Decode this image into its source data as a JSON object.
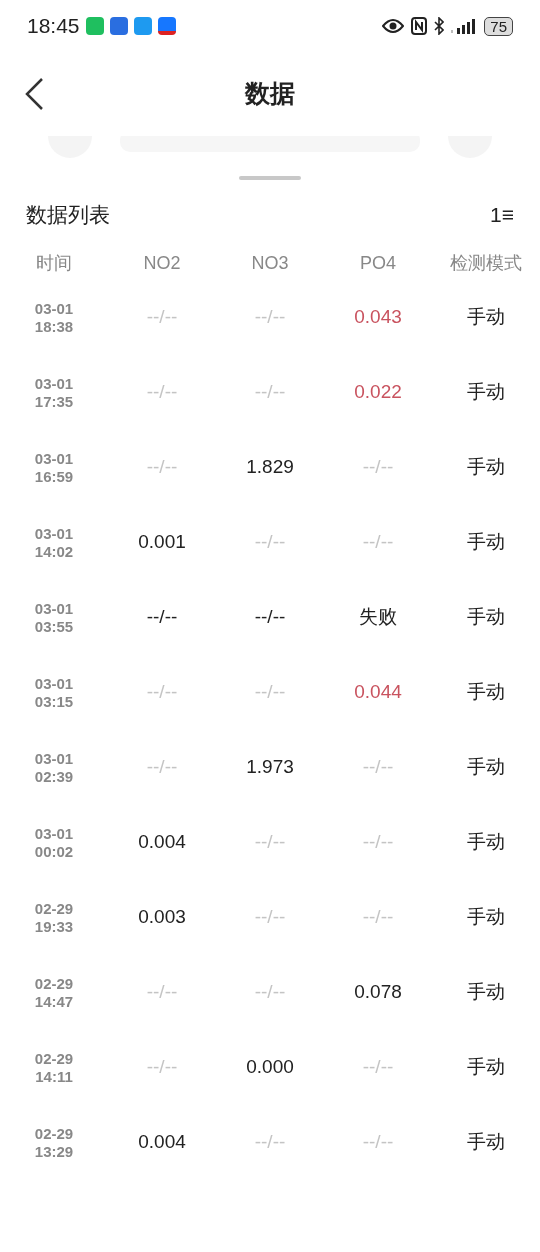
{
  "status_bar": {
    "time": "18:45",
    "battery": "75"
  },
  "header": {
    "title": "数据"
  },
  "list": {
    "title": "数据列表",
    "sort_label": "1≡"
  },
  "table": {
    "columns": [
      "时间",
      "NO2",
      "NO3",
      "PO4",
      "检测模式"
    ],
    "rows": [
      {
        "cells": [
          {
            "text": "03-01 18:38",
            "kind": "time"
          },
          {
            "text": "--/--",
            "kind": "empty"
          },
          {
            "text": "--/--",
            "kind": "empty"
          },
          {
            "text": "0.043",
            "kind": "high"
          },
          {
            "text": "手动",
            "kind": "normal"
          }
        ]
      },
      {
        "cells": [
          {
            "text": "03-01 17:35",
            "kind": "time"
          },
          {
            "text": "--/--",
            "kind": "empty"
          },
          {
            "text": "--/--",
            "kind": "empty"
          },
          {
            "text": "0.022",
            "kind": "high"
          },
          {
            "text": "手动",
            "kind": "normal"
          }
        ]
      },
      {
        "cells": [
          {
            "text": "03-01 16:59",
            "kind": "time"
          },
          {
            "text": "--/--",
            "kind": "empty"
          },
          {
            "text": "1.829",
            "kind": "normal"
          },
          {
            "text": "--/--",
            "kind": "empty"
          },
          {
            "text": "手动",
            "kind": "normal"
          }
        ]
      },
      {
        "cells": [
          {
            "text": "03-01 14:02",
            "kind": "time"
          },
          {
            "text": "0.001",
            "kind": "normal"
          },
          {
            "text": "--/--",
            "kind": "empty"
          },
          {
            "text": "--/--",
            "kind": "empty"
          },
          {
            "text": "手动",
            "kind": "normal"
          }
        ]
      },
      {
        "cells": [
          {
            "text": "03-01 03:55",
            "kind": "time"
          },
          {
            "text": "--/--",
            "kind": "normal"
          },
          {
            "text": "--/--",
            "kind": "normal"
          },
          {
            "text": "失败",
            "kind": "normal"
          },
          {
            "text": "手动",
            "kind": "normal"
          }
        ]
      },
      {
        "cells": [
          {
            "text": "03-01 03:15",
            "kind": "time"
          },
          {
            "text": "--/--",
            "kind": "empty"
          },
          {
            "text": "--/--",
            "kind": "empty"
          },
          {
            "text": "0.044",
            "kind": "high"
          },
          {
            "text": "手动",
            "kind": "normal"
          }
        ]
      },
      {
        "cells": [
          {
            "text": "03-01 02:39",
            "kind": "time"
          },
          {
            "text": "--/--",
            "kind": "empty"
          },
          {
            "text": "1.973",
            "kind": "normal"
          },
          {
            "text": "--/--",
            "kind": "empty"
          },
          {
            "text": "手动",
            "kind": "normal"
          }
        ]
      },
      {
        "cells": [
          {
            "text": "03-01 00:02",
            "kind": "time"
          },
          {
            "text": "0.004",
            "kind": "normal"
          },
          {
            "text": "--/--",
            "kind": "empty"
          },
          {
            "text": "--/--",
            "kind": "empty"
          },
          {
            "text": "手动",
            "kind": "normal"
          }
        ]
      },
      {
        "cells": [
          {
            "text": "02-29 19:33",
            "kind": "time"
          },
          {
            "text": "0.003",
            "kind": "normal"
          },
          {
            "text": "--/--",
            "kind": "empty"
          },
          {
            "text": "--/--",
            "kind": "empty"
          },
          {
            "text": "手动",
            "kind": "normal"
          }
        ]
      },
      {
        "cells": [
          {
            "text": "02-29 14:47",
            "kind": "time"
          },
          {
            "text": "--/--",
            "kind": "empty"
          },
          {
            "text": "--/--",
            "kind": "empty"
          },
          {
            "text": "0.078",
            "kind": "normal"
          },
          {
            "text": "手动",
            "kind": "normal"
          }
        ]
      },
      {
        "cells": [
          {
            "text": "02-29 14:11",
            "kind": "time"
          },
          {
            "text": "--/--",
            "kind": "empty"
          },
          {
            "text": "0.000",
            "kind": "normal"
          },
          {
            "text": "--/--",
            "kind": "empty"
          },
          {
            "text": "手动",
            "kind": "normal"
          }
        ]
      },
      {
        "cells": [
          {
            "text": "02-29 13:29",
            "kind": "time"
          },
          {
            "text": "0.004",
            "kind": "normal"
          },
          {
            "text": "--/--",
            "kind": "empty"
          },
          {
            "text": "--/--",
            "kind": "empty"
          },
          {
            "text": "手动",
            "kind": "normal"
          }
        ]
      }
    ]
  }
}
